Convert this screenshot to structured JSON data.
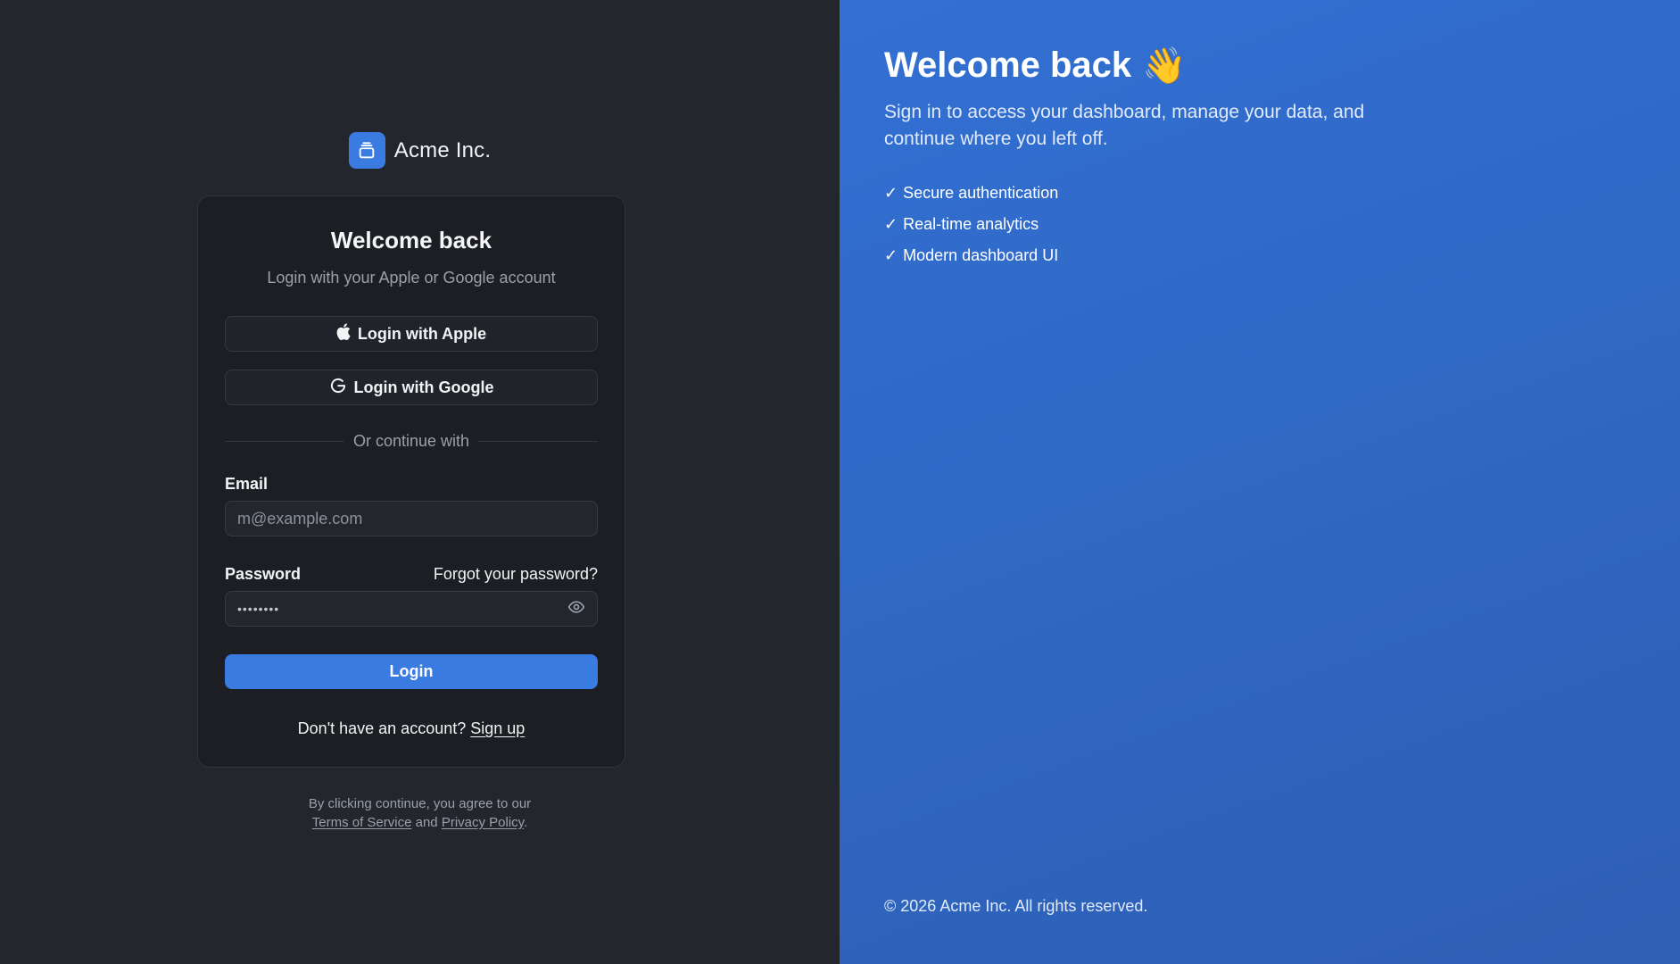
{
  "brand": {
    "name": "Acme Inc.",
    "logo_icon": "layers-icon"
  },
  "card": {
    "title": "Welcome back",
    "subtitle": "Login with your Apple or Google account",
    "apple_button": "Login with Apple",
    "google_button": "Login with Google",
    "divider": "Or continue with",
    "email_label": "Email",
    "email_placeholder": "m@example.com",
    "password_label": "Password",
    "forgot_link": "Forgot your password?",
    "password_value": "••••••••",
    "login_button": "Login",
    "signup_prompt": "Don't have an account?",
    "signup_link": "Sign up"
  },
  "legal": {
    "prefix": "By clicking continue, you agree to our",
    "terms": "Terms of Service",
    "and": "and",
    "privacy": "Privacy Policy",
    "suffix": "."
  },
  "hero": {
    "title": "Welcome back",
    "emoji": "👋",
    "subtitle": "Sign in to access your dashboard, manage your data, and continue where you left off.",
    "features": [
      "Secure authentication",
      "Real-time analytics",
      "Modern dashboard UI"
    ],
    "check": "✓",
    "copyright": "© 2026 Acme Inc. All rights reserved."
  },
  "colors": {
    "accent": "#3a7be2",
    "panel_bg": "#23262d",
    "card_bg": "#1c1e23",
    "hero_bg": "#3270d3"
  }
}
